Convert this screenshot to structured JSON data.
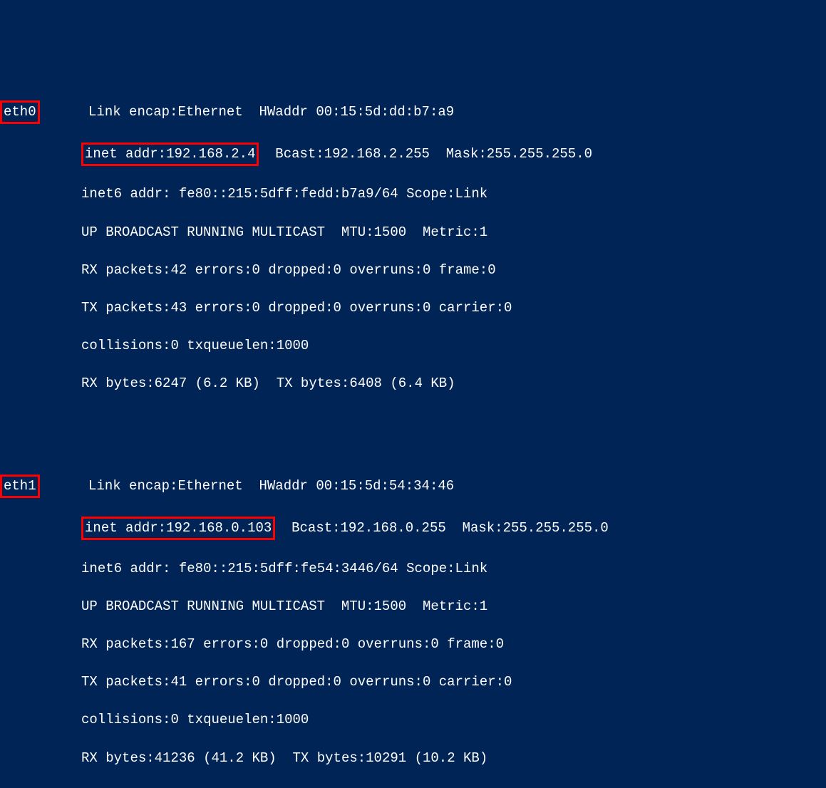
{
  "interfaces": [
    {
      "name": "eth0",
      "link_encap": "Ethernet",
      "hwaddr": "00:15:5d:dd:b7:a9",
      "inet_addr": "192.168.2.4",
      "bcast": "192.168.2.255",
      "mask": "255.255.255.0",
      "inet6_addr": "fe80::215:5dff:fedd:b7a9/64",
      "scope": "Link",
      "flags": "UP BROADCAST RUNNING MULTICAST",
      "mtu": "1500",
      "metric": "1",
      "rx_packets": "42",
      "rx_errors": "0",
      "rx_dropped": "0",
      "rx_overruns": "0",
      "rx_frame": "0",
      "tx_packets": "43",
      "tx_errors": "0",
      "tx_dropped": "0",
      "tx_overruns": "0",
      "tx_carrier": "0",
      "collisions": "0",
      "txqueuelen": "1000",
      "rx_bytes": "6247",
      "rx_bytes_human": "6.2 KB",
      "tx_bytes": "6408",
      "tx_bytes_human": "6.4 KB"
    },
    {
      "name": "eth1",
      "link_encap": "Ethernet",
      "hwaddr": "00:15:5d:54:34:46",
      "inet_addr": "192.168.0.103",
      "bcast": "192.168.0.255",
      "mask": "255.255.255.0",
      "inet6_addr": "fe80::215:5dff:fe54:3446/64",
      "scope": "Link",
      "flags": "UP BROADCAST RUNNING MULTICAST",
      "mtu": "1500",
      "metric": "1",
      "rx_packets": "167",
      "rx_errors": "0",
      "rx_dropped": "0",
      "rx_overruns": "0",
      "rx_frame": "0",
      "tx_packets": "41",
      "tx_errors": "0",
      "tx_dropped": "0",
      "tx_overruns": "0",
      "tx_carrier": "0",
      "collisions": "0",
      "txqueuelen": "1000",
      "rx_bytes": "41236",
      "rx_bytes_human": "41.2 KB",
      "tx_bytes": "10291",
      "tx_bytes_human": "10.2 KB"
    }
  ],
  "labels": {
    "link_encap": "Link encap:",
    "hwaddr": "HWaddr",
    "inet_addr": "inet addr:",
    "bcast": "Bcast:",
    "mask": "Mask:",
    "inet6_addr": "inet6 addr:",
    "scope": "Scope:",
    "mtu": "MTU:",
    "metric": "Metric:",
    "rx_packets": "RX packets:",
    "tx_packets": "TX packets:",
    "errors": "errors:",
    "dropped": "dropped:",
    "overruns": "overruns:",
    "frame": "frame:",
    "carrier": "carrier:",
    "collisions": "collisions:",
    "txqueuelen": "txqueuelen:",
    "rx_bytes": "RX bytes:",
    "tx_bytes": "TX bytes:"
  }
}
